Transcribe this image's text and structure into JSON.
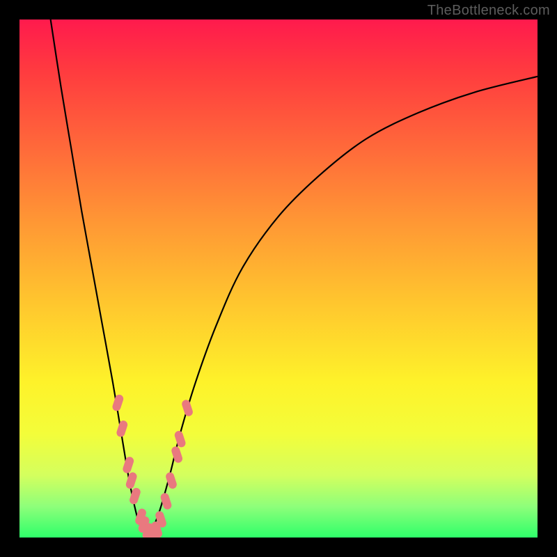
{
  "watermark": "TheBottleneck.com",
  "chart_data": {
    "type": "line",
    "title": "",
    "xlabel": "",
    "ylabel": "",
    "xlim": [
      0,
      100
    ],
    "ylim": [
      0,
      100
    ],
    "grid": false,
    "legend": false,
    "background_gradient": {
      "top_color": "#ff1a4d",
      "mid_color": "#fef22a",
      "bottom_color": "#2eff6a"
    },
    "series": [
      {
        "name": "curve-left",
        "x": [
          6,
          8,
          10,
          12,
          14,
          16,
          18,
          20,
          21,
          22,
          23,
          24,
          25
        ],
        "y": [
          100,
          87,
          75,
          63,
          52,
          41,
          30,
          18,
          12,
          7,
          3,
          1,
          0
        ]
      },
      {
        "name": "curve-right",
        "x": [
          25,
          27,
          29,
          31,
          34,
          38,
          43,
          50,
          58,
          67,
          77,
          88,
          100
        ],
        "y": [
          0,
          5,
          12,
          20,
          30,
          41,
          52,
          62,
          70,
          77,
          82,
          86,
          89
        ]
      }
    ],
    "markers": {
      "name": "highlight-points",
      "color": "#e9797f",
      "shape": "rounded-rect",
      "points": [
        {
          "x": 19.0,
          "y": 26
        },
        {
          "x": 19.8,
          "y": 21
        },
        {
          "x": 21.0,
          "y": 14
        },
        {
          "x": 21.6,
          "y": 11
        },
        {
          "x": 22.3,
          "y": 8
        },
        {
          "x": 23.4,
          "y": 4
        },
        {
          "x": 24.0,
          "y": 2.5
        },
        {
          "x": 24.8,
          "y": 1.2
        },
        {
          "x": 25.6,
          "y": 0.8
        },
        {
          "x": 26.5,
          "y": 1.5
        },
        {
          "x": 27.3,
          "y": 3.5
        },
        {
          "x": 28.3,
          "y": 7
        },
        {
          "x": 29.3,
          "y": 11
        },
        {
          "x": 30.4,
          "y": 16
        },
        {
          "x": 31.0,
          "y": 19
        },
        {
          "x": 32.4,
          "y": 25
        }
      ]
    }
  }
}
